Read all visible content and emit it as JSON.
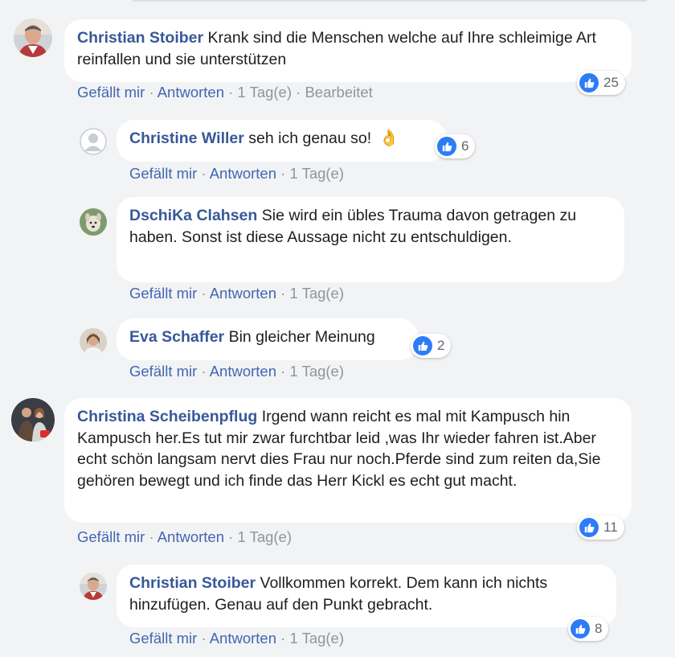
{
  "comments": [
    {
      "author": "Christian Stoiber",
      "text": "Krank sind die Menschen welche auf Ihre schleimige Art reinfallen und sie unterstützen",
      "like": "Gefällt mir",
      "reply": "Antworten",
      "time": "1 Tag(e)",
      "edited": "Bearbeitet",
      "reactions": "25",
      "avatar_icon": "profile-photo-man"
    },
    {
      "author": "Christine Willer",
      "text": "seh ich genau so!",
      "emoji": "👌",
      "like": "Gefällt mir",
      "reply": "Antworten",
      "time": "1 Tag(e)",
      "reactions": "6",
      "avatar_icon": "default-profile-icon"
    },
    {
      "author": "DschiKa Clahsen",
      "text": "Sie wird ein übles Trauma davon getragen zu haben. Sonst ist diese Aussage nicht zu entschuldigen.",
      "like": "Gefällt mir",
      "reply": "Antworten",
      "time": "1 Tag(e)",
      "avatar_icon": "profile-photo-dog"
    },
    {
      "author": "Eva Schaffer",
      "text": "Bin gleicher Meinung",
      "like": "Gefällt mir",
      "reply": "Antworten",
      "time": "1 Tag(e)",
      "reactions": "2",
      "avatar_icon": "profile-photo-woman"
    },
    {
      "author": "Christina Scheibenpflug",
      "text": "Irgend wann reicht es mal mit Kampusch hin Kampusch her.Es tut mir zwar furchtbar leid ,was Ihr wieder fahren ist.Aber echt schön langsam nervt dies Frau nur noch.Pferde sind zum reiten da,Sie gehören bewegt und ich finde das Herr Kickl es echt gut macht.",
      "like": "Gefällt mir",
      "reply": "Antworten",
      "time": "1 Tag(e)",
      "reactions": "11",
      "avatar_icon": "profile-photo-couple"
    },
    {
      "author": "Christian Stoiber",
      "text": "Vollkommen korrekt. Dem kann ich nichts hinzufügen. Genau auf den Punkt gebracht.",
      "like": "Gefällt mir",
      "reply": "Antworten",
      "time": "1 Tag(e)",
      "reactions": "8",
      "avatar_icon": "profile-photo-man"
    }
  ],
  "colors": {
    "author": "#385898",
    "link": "#4267b2",
    "meta": "#90949c",
    "like_badge": "#2d7cf6",
    "background": "#f2f3f5"
  }
}
